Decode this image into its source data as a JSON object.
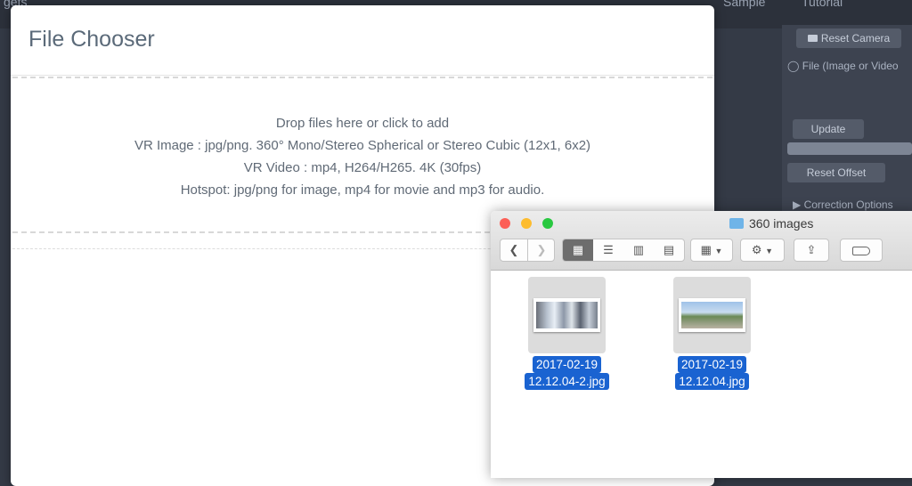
{
  "background_app": {
    "nav_left": "gets",
    "nav_sample": "Sample",
    "nav_tutorial": "Tutorial",
    "reset_camera": "Reset Camera",
    "file_label": "File (Image or Video",
    "update": "Update",
    "reset_offset": "Reset Offset",
    "correction_options": "▶ Correction Options"
  },
  "modal": {
    "title": "File Chooser",
    "dropzone_lines": [
      "Drop files here or click to add",
      "VR Image : jpg/png. 360° Mono/Stereo Spherical or Stereo Cubic (12x1, 6x2)",
      "VR Video : mp4, H264/H265. 4K (30fps)",
      "Hotspot: jpg/png for image, mp4 for movie and mp3 for audio."
    ]
  },
  "finder": {
    "title": "360 images",
    "files": [
      {
        "name_line1": "2017-02-19",
        "name_line2": "12.12.04-2.jpg"
      },
      {
        "name_line1": "2017-02-19",
        "name_line2": "12.12.04.jpg"
      }
    ],
    "colors": {
      "close": "#fc5f57",
      "minimize": "#fdbc2e",
      "zoom": "#28c840",
      "selection": "#1a63d1"
    }
  }
}
